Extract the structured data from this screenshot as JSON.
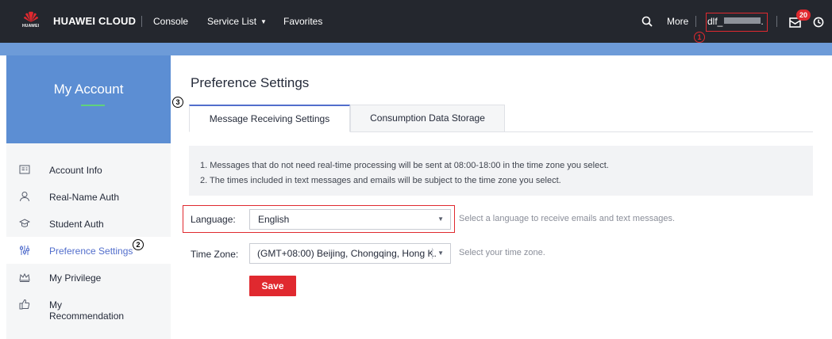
{
  "header": {
    "logo_text": "HUAWEI",
    "brand": "HUAWEI CLOUD",
    "nav": [
      "Console",
      "Service List",
      "Favorites"
    ],
    "more_label": "More",
    "username": "dlf_",
    "user_suffix": ".",
    "notification_count": "20",
    "icons": [
      "search-icon",
      "mail-icon",
      "clock-icon",
      "chevron-down-icon"
    ],
    "callout_1": "1"
  },
  "sidebar": {
    "title": "My Account",
    "items": [
      {
        "label": "Account Info",
        "icon": "id-card-icon"
      },
      {
        "label": "Real-Name Auth",
        "icon": "user-icon"
      },
      {
        "label": "Student Auth",
        "icon": "graduation-cap-icon"
      },
      {
        "label": "Preference Settings",
        "icon": "sliders-icon"
      },
      {
        "label": "My Privilege",
        "icon": "crown-icon"
      },
      {
        "label": "My Recommendation",
        "icon": "thumbs-up-icon"
      }
    ],
    "callout_2": "2"
  },
  "main": {
    "title": "Preference Settings",
    "callout_3": "3",
    "tabs": [
      "Message Receiving Settings",
      "Consumption Data Storage"
    ],
    "notice": [
      "1. Messages that do not need real-time processing will be sent at 08:00-18:00 in the time zone you select.",
      "2. The times included in text messages and emails will be subject to the time zone you select."
    ],
    "language": {
      "label": "Language:",
      "value": "English",
      "hint": "Select a language to receive emails and text messages."
    },
    "timezone": {
      "label": "Time Zone:",
      "value": "(GMT+08:00) Beijing, Chongqing, Hong K...",
      "hint": "Select your time zone."
    },
    "save_label": "Save"
  },
  "colors": {
    "topbar": "#24272e",
    "band": "#6d9bd8",
    "sidebar_head": "#5c8ed3",
    "accent": "#526ecc",
    "annotation_red": "#e0292f",
    "save_button": "#e0292f",
    "sidebar_underline": "#60d27c"
  }
}
